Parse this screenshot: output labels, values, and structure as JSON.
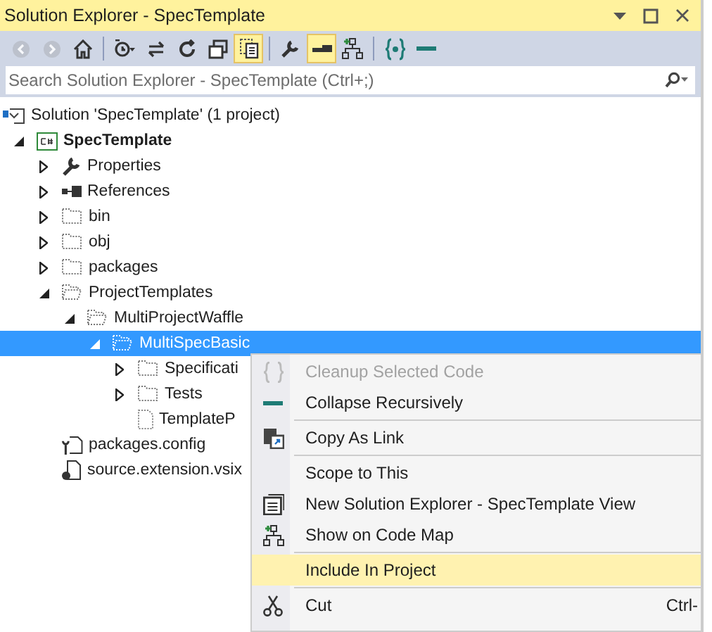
{
  "window": {
    "title": "Solution Explorer - SpecTemplate"
  },
  "toolbar": [
    [
      {
        "kind": "back",
        "disabled": true,
        "pressed": false
      },
      {
        "kind": "forward",
        "disabled": true,
        "pressed": false
      },
      {
        "kind": "home",
        "disabled": false,
        "pressed": false
      }
    ],
    [
      {
        "kind": "history",
        "disabled": false,
        "pressed": false
      },
      {
        "kind": "sync",
        "disabled": false,
        "pressed": false
      },
      {
        "kind": "refresh",
        "disabled": false,
        "pressed": false
      },
      {
        "kind": "collapse",
        "disabled": false,
        "pressed": false
      },
      {
        "kind": "showall",
        "disabled": false,
        "pressed": true
      }
    ],
    [
      {
        "kind": "wrench",
        "disabled": false,
        "pressed": false
      },
      {
        "kind": "preview",
        "disabled": false,
        "pressed": true
      },
      {
        "kind": "codemap",
        "disabled": false,
        "pressed": false
      }
    ],
    [
      {
        "kind": "braces",
        "disabled": false,
        "pressed": false
      },
      {
        "kind": "dash",
        "disabled": false,
        "pressed": false
      }
    ]
  ],
  "search": {
    "placeholder": "Search Solution Explorer - SpecTemplate (Ctrl+;)"
  },
  "tree": [
    {
      "label": "Solution 'SpecTemplate' (1 project)",
      "kind": "solution",
      "selected": false,
      "children": [
        {
          "label": "SpecTemplate",
          "kind": "project",
          "expanded": true,
          "selected": false,
          "children": [
            {
              "label": "Properties",
              "kind": "properties",
              "expanded": false,
              "selected": false
            },
            {
              "label": "References",
              "kind": "references",
              "expanded": false,
              "selected": false
            },
            {
              "label": "bin",
              "kind": "folder",
              "expanded": false,
              "selected": false
            },
            {
              "label": "obj",
              "kind": "folder",
              "expanded": false,
              "selected": false
            },
            {
              "label": "packages",
              "kind": "folder",
              "expanded": false,
              "selected": false
            },
            {
              "label": "ProjectTemplates",
              "kind": "folder",
              "expanded": true,
              "selected": false,
              "children": [
                {
                  "label": "MultiProjectWaffle",
                  "kind": "folder",
                  "expanded": true,
                  "selected": false,
                  "children": [
                    {
                      "label": "MultiSpecBasic",
                      "kind": "folder",
                      "expanded": true,
                      "selected": true,
                      "children": [
                        {
                          "label": "Specificati",
                          "kind": "folder",
                          "expanded": false,
                          "selected": false
                        },
                        {
                          "label": "Tests",
                          "kind": "folder",
                          "expanded": false,
                          "selected": false
                        },
                        {
                          "label": "TemplateP",
                          "kind": "file",
                          "selected": false
                        }
                      ]
                    }
                  ]
                }
              ]
            },
            {
              "label": "packages.config",
              "kind": "config",
              "selected": false
            },
            {
              "label": "source.extension.vsix",
              "kind": "vsix",
              "selected": false
            }
          ]
        }
      ]
    }
  ],
  "context_menu": [
    [
      {
        "label": "Cleanup Selected Code",
        "kind": "braces",
        "disabled": true,
        "selected": false
      },
      {
        "label": "Collapse Recursively",
        "kind": "dash",
        "disabled": false,
        "selected": false
      }
    ],
    [
      {
        "label": "Copy As Link",
        "kind": "copylink",
        "disabled": false,
        "selected": false
      }
    ],
    [
      {
        "label": "Scope to This",
        "kind": "plain",
        "disabled": false,
        "selected": false
      },
      {
        "label": "New Solution Explorer - SpecTemplate View",
        "kind": "newview",
        "disabled": false,
        "selected": false
      },
      {
        "label": "Show on Code Map",
        "kind": "codemap",
        "disabled": false,
        "selected": false
      }
    ],
    [
      {
        "label": "Include In Project",
        "kind": "plain",
        "disabled": false,
        "selected": true
      }
    ],
    [
      {
        "label": "Cut",
        "kind": "scissors",
        "shortcut": "Ctrl-",
        "disabled": false,
        "selected": false
      }
    ]
  ]
}
